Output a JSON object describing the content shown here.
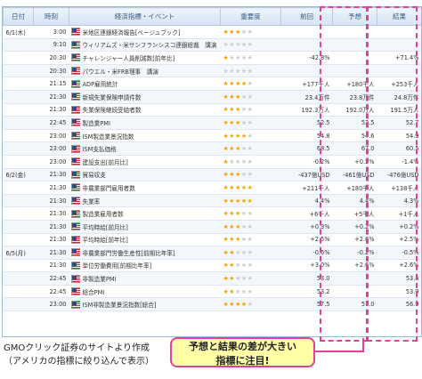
{
  "headers": [
    "日付",
    "時刻",
    "経済指標・イベント",
    "重要度",
    "前回",
    "予想",
    "結果"
  ],
  "rows": [
    {
      "date": "6/1(木)",
      "time": "3:00",
      "name": "米地区連銀経済報告[ベージュブック]",
      "stars": 3,
      "prev": "",
      "fcst": "",
      "act": ""
    },
    {
      "date": "",
      "time": "9:10",
      "name": "ウィリアムズ・米サンフランシスコ連銀総裁　講演",
      "stars": 0,
      "prev": "",
      "fcst": "",
      "act": ""
    },
    {
      "date": "",
      "time": "20:30",
      "name": "チャレンジャー人員削減数[前年比]",
      "stars": 1,
      "prev": "-42.8%",
      "fcst": "",
      "act": "+71.4%"
    },
    {
      "date": "",
      "time": "20:30",
      "name": "パウエル・米FRB理事　講演",
      "stars": 0,
      "prev": "",
      "fcst": "",
      "act": ""
    },
    {
      "date": "",
      "time": "21:15",
      "name": "ADP雇用統計",
      "stars": 4,
      "prev": "+177千人",
      "fcst": "+180千人",
      "act": "+253千人"
    },
    {
      "date": "",
      "time": "21:30",
      "name": "新規失業保険申請件数",
      "stars": 3,
      "prev": "23.4万件",
      "fcst": "23.8万件",
      "act": "24.8万件"
    },
    {
      "date": "",
      "time": "21:30",
      "name": "失業保険継続受給者数",
      "stars": 3,
      "prev": "192.3万人",
      "fcst": "192.0万人",
      "act": "191.5万人"
    },
    {
      "date": "",
      "time": "22:45",
      "name": "製造業PMI",
      "stars": 3,
      "prev": "52.5",
      "fcst": "52.5",
      "act": "52.7"
    },
    {
      "date": "",
      "time": "23:00",
      "name": "ISM製造業景況指数",
      "stars": 4,
      "prev": "54.8",
      "fcst": "54.6",
      "act": "54.9"
    },
    {
      "date": "",
      "time": "23:00",
      "name": "ISM支払価格",
      "stars": 3,
      "prev": "68.5",
      "fcst": "67.0",
      "act": "60.5"
    },
    {
      "date": "",
      "time": "23:00",
      "name": "建設支出[前月比]",
      "stars": 1,
      "prev": "-0.2%",
      "fcst": "+0.5%",
      "act": "-1.4%"
    },
    {
      "date": "6/2(金)",
      "time": "21:30",
      "name": "貿易収支",
      "stars": 3,
      "prev": "-437億USD",
      "fcst": "-461億USD",
      "act": "-476億USD"
    },
    {
      "date": "",
      "time": "21:30",
      "name": "非農業部門雇用者数",
      "stars": 5,
      "prev": "+211千人",
      "fcst": "+180千人",
      "act": "+138千人"
    },
    {
      "date": "",
      "time": "21:30",
      "name": "失業率",
      "stars": 5,
      "prev": "4.4%",
      "fcst": "4.4%",
      "act": "4.3%"
    },
    {
      "date": "",
      "time": "21:30",
      "name": "製造業雇用者数",
      "stars": 3,
      "prev": "+6千人",
      "fcst": "+5千人",
      "act": "+1千人"
    },
    {
      "date": "",
      "time": "21:30",
      "name": "平均時給[前月比]",
      "stars": 3,
      "prev": "+0.3%",
      "fcst": "+0.2%",
      "act": "+0.2%"
    },
    {
      "date": "",
      "time": "21:30",
      "name": "平均時給[前年比]",
      "stars": 3,
      "prev": "+2.5%",
      "fcst": "+2.6%",
      "act": "+2.5%"
    },
    {
      "date": "6/5(月)",
      "time": "21:30",
      "name": "非農業部門労働生産性[前期比年率]",
      "stars": 2,
      "prev": "-0.6%",
      "fcst": "-0.2%",
      "act": "-0.5%"
    },
    {
      "date": "",
      "time": "21:30",
      "name": "単位労働費用[前期比年率]",
      "stars": 2,
      "prev": "+3.0%",
      "fcst": "+2.6%",
      "act": "+2.6%"
    },
    {
      "date": "",
      "time": "22:45",
      "name": "非製造業PMI",
      "stars": 2,
      "prev": "53.0",
      "fcst": "",
      "act": "53.6"
    },
    {
      "date": "",
      "time": "22:45",
      "name": "総合PMI",
      "stars": 2,
      "prev": "53.2",
      "fcst": "",
      "act": "53.9"
    },
    {
      "date": "",
      "time": "23:00",
      "name": "ISM非製造業景況指数[総合]",
      "stars": 4,
      "prev": "57.5",
      "fcst": "57.0",
      "act": "56.9"
    }
  ],
  "caption_line1": "GMOクリック証券のサイトより作成",
  "caption_line2": "（アメリカの指標に絞り込んで表示）",
  "callout_line1": "予想と結果の差が大きい",
  "callout_line2": "指標に注目!",
  "colors": {
    "highlight": "#e2419b",
    "callout_bg": "#ffffa8",
    "star": "#f0a500"
  }
}
